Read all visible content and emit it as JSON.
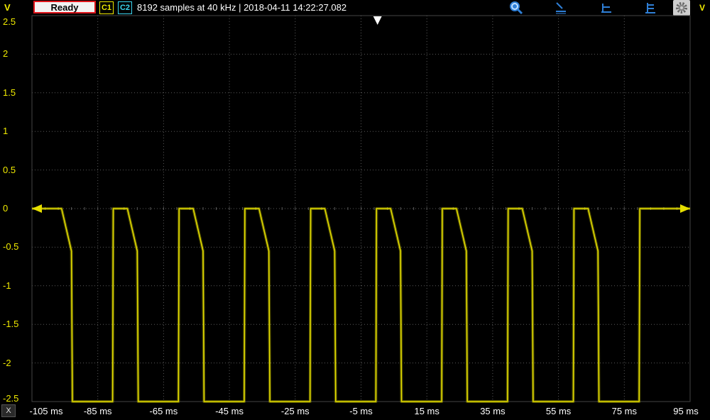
{
  "toolbar": {
    "status": "Ready",
    "channel1": "C1",
    "channel2": "C2",
    "acquisition_info": "8192 samples at 40 kHz | 2018-04-11 14:22:27.082",
    "icons": [
      "zoom-icon",
      "cursor-marker-icon",
      "baseline-marker-icon",
      "stack-marker-icon",
      "settings-gear-icon"
    ],
    "unit_label": "V"
  },
  "colors": {
    "trace": "#e6df00",
    "grid": "#5a5a5a",
    "background": "#000000",
    "status_border": "#e0151b",
    "channel2": "#3bd6f0"
  },
  "chart_data": {
    "type": "line",
    "xlabel_unit": "ms",
    "ylabel_unit": "V",
    "xlim": [
      -105,
      95
    ],
    "ylim": [
      -2.5,
      2.5
    ],
    "x_ticks": [
      "-105 ms",
      "-85 ms",
      "-65 ms",
      "-45 ms",
      "-25 ms",
      "-5 ms",
      "15 ms",
      "35 ms",
      "55 ms",
      "75 ms",
      "95 ms"
    ],
    "y_ticks": [
      "2.5",
      "2",
      "1.5",
      "1",
      "0.5",
      "0",
      "-0.5",
      "-1",
      "-1.5",
      "-2",
      "-2.5"
    ],
    "grid": true,
    "series": [
      {
        "x": [
          -105,
          -96,
          -93,
          -92.7,
          -92.5,
          -81,
          -80.5,
          -80.3,
          -80,
          -76,
          -73,
          -72.7,
          -72.5,
          -61,
          -60.5,
          -60.3,
          -60,
          -56,
          -53,
          -52.7,
          -52.5,
          -41,
          -40.5,
          -40.3,
          -40,
          -36,
          -33,
          -32.7,
          -32.5,
          -21,
          -20.5,
          -20.3,
          -20,
          -16,
          -13,
          -12.7,
          -12.5,
          -1,
          -0.5,
          -0.3,
          0,
          4,
          7,
          7.3,
          7.5,
          19,
          19.5,
          19.7,
          20,
          24,
          27,
          27.3,
          27.5,
          39,
          39.5,
          39.7,
          40,
          44,
          47,
          47.3,
          47.5,
          59,
          59.5,
          59.7,
          60,
          64,
          67,
          67.3,
          67.5,
          79,
          79.5,
          79.7,
          80,
          95
        ],
        "y": [
          0,
          0,
          -0.55,
          -2.5,
          -2.5,
          -2.5,
          -2.5,
          0,
          0,
          0,
          -0.55,
          -2.5,
          -2.5,
          -2.5,
          -2.5,
          0,
          0,
          0,
          -0.55,
          -2.5,
          -2.5,
          -2.5,
          -2.5,
          0,
          0,
          0,
          -0.55,
          -2.5,
          -2.5,
          -2.5,
          -2.5,
          0,
          0,
          0,
          -0.55,
          -2.5,
          -2.5,
          -2.5,
          -2.5,
          0,
          0,
          0,
          -0.55,
          -2.5,
          -2.5,
          -2.5,
          -2.5,
          0,
          0,
          0,
          -0.55,
          -2.5,
          -2.5,
          -2.5,
          -2.5,
          0,
          0,
          0,
          -0.55,
          -2.5,
          -2.5,
          -2.5,
          -2.5,
          0,
          0,
          0,
          -0.55,
          -2.5,
          -2.5,
          -2.5,
          -2.5,
          0,
          0,
          0
        ]
      }
    ],
    "trigger_level": 0,
    "trigger_time": 0
  }
}
